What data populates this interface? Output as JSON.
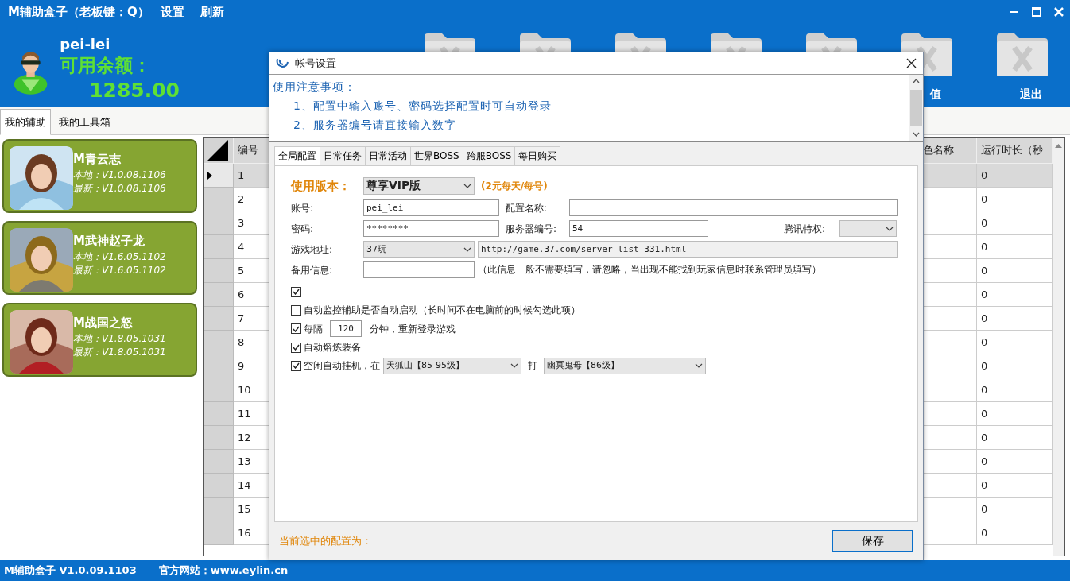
{
  "window": {
    "title": "M辅助盒子（老板键：Q）",
    "menu": [
      "设置",
      "刷新"
    ]
  },
  "user": {
    "name": "pei-lei",
    "balance_label": "可用余额：",
    "balance": "1285.00"
  },
  "toolbar": [
    {
      "label": "值"
    },
    {
      "label": "退出"
    }
  ],
  "side_tabs": [
    {
      "label": "我的辅助",
      "selected": true
    },
    {
      "label": "我的工具箱",
      "selected": false
    }
  ],
  "games": [
    {
      "name": "M青云志",
      "local": "本地：V1.0.08.1106",
      "latest": "最新：V1.0.08.1106"
    },
    {
      "name": "M武神赵子龙",
      "local": "本地：V1.6.05.1102",
      "latest": "最新：V1.6.05.1102"
    },
    {
      "name": "M战国之怒",
      "local": "本地：V1.8.05.1031",
      "latest": "最新：V1.8.05.1031"
    }
  ],
  "grid": {
    "columns": [
      "编号",
      "色名称",
      "运行时长（秒"
    ],
    "rows": [
      {
        "number": "1",
        "runtime": "0",
        "selected": true
      },
      {
        "number": "2",
        "runtime": "0",
        "selected": false
      },
      {
        "number": "3",
        "runtime": "0",
        "selected": false
      },
      {
        "number": "4",
        "runtime": "0",
        "selected": false
      },
      {
        "number": "5",
        "runtime": "0",
        "selected": false
      },
      {
        "number": "6",
        "runtime": "0",
        "selected": false
      },
      {
        "number": "7",
        "runtime": "0",
        "selected": false
      },
      {
        "number": "8",
        "runtime": "0",
        "selected": false
      },
      {
        "number": "9",
        "runtime": "0",
        "selected": false
      },
      {
        "number": "10",
        "runtime": "0",
        "selected": false
      },
      {
        "number": "11",
        "runtime": "0",
        "selected": false
      },
      {
        "number": "12",
        "runtime": "0",
        "selected": false
      },
      {
        "number": "13",
        "runtime": "0",
        "selected": false
      },
      {
        "number": "14",
        "runtime": "0",
        "selected": false
      },
      {
        "number": "15",
        "runtime": "0",
        "selected": false
      },
      {
        "number": "16",
        "runtime": "0",
        "selected": false
      }
    ]
  },
  "dialog": {
    "title": "帐号设置",
    "notes": [
      "使用注意事项：",
      "1、配置中输入账号、密码选择配置时可自动登录",
      "2、服务器编号请直接输入数字"
    ],
    "tabs": [
      {
        "label": "全局配置",
        "selected": true
      },
      {
        "label": "日常任务",
        "selected": false
      },
      {
        "label": "日常活动",
        "selected": false
      },
      {
        "label": "世界BOSS",
        "selected": false
      },
      {
        "label": "跨服BOSS",
        "selected": false
      },
      {
        "label": "每日购买",
        "selected": false
      }
    ],
    "form": {
      "version_label": "使用版本：",
      "version": "尊享VIP版",
      "version_note": "(2元每天/每号)",
      "account_label": "账号:",
      "account": "pei_lei",
      "config_name_label": "配置名称:",
      "password_label": "密码:",
      "password": "********",
      "server_label": "服务器编号:",
      "server": "54",
      "tencent_label": "腾讯特权:",
      "address_label": "游戏地址:",
      "address_site": "37玩",
      "address_url": "http://game.37.com/server_list_331.html",
      "backup_label": "备用信息:",
      "backup_note": "（此信息一般不需要填写，请忽略，当出现不能找到玩家信息时联系管理员填写）"
    },
    "options": [
      {
        "kind": "check",
        "checked": true
      },
      {
        "kind": "check",
        "checked": false,
        "label": "自动监控辅助是否自动启动（长时间不在电脑前的时候勾选此项）"
      },
      {
        "kind": "interval",
        "checked": true,
        "label": "每隔",
        "value": "120",
        "suffix": "分钟，重新登录游戏"
      },
      {
        "kind": "check",
        "checked": true,
        "label": "自动熔炼装备"
      },
      {
        "kind": "idle",
        "checked": true,
        "label": "空闲自动挂机，在",
        "map": "天狐山【85-95级】",
        "action": "打",
        "target": "幽冥鬼母【86级】"
      }
    ],
    "footer": "当前选中的配置为：",
    "save": "保存"
  },
  "status_bar": [
    "M辅助盒子 V1.0.09.1103",
    "官方网站：www.eylin.cn"
  ]
}
